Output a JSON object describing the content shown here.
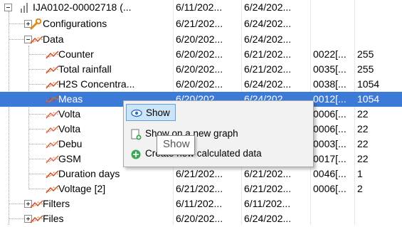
{
  "colors": {
    "selection": "#3b7ad6",
    "menu_hover": "#cce4f7",
    "menu_bg": "#f2f2f2"
  },
  "tree": {
    "rows": [
      {
        "name": "IJA0102-00002718 (...",
        "c1": "6/11/202...",
        "c2": "6/24/202...",
        "c3": "",
        "c4": "",
        "icon": "bar-chart-icon"
      },
      {
        "name": "Configurations",
        "c1": "6/21/202...",
        "c2": "6/24/202...",
        "c3": "",
        "c4": "",
        "icon": "wrench-icon"
      },
      {
        "name": "Data",
        "c1": "6/20/202...",
        "c2": "6/24/202...",
        "c3": "",
        "c4": "",
        "icon": "series-icon"
      },
      {
        "name": "Counter",
        "c1": "6/20/202...",
        "c2": "6/21/202...",
        "c3": "0022[...",
        "c4": "255",
        "icon": "series-icon"
      },
      {
        "name": "Total rainfall",
        "c1": "6/20/202...",
        "c2": "6/21/202...",
        "c3": "0035[...",
        "c4": "255",
        "icon": "series-icon"
      },
      {
        "name": "H2S Concentra...",
        "c1": "6/20/202...",
        "c2": "6/24/202...",
        "c3": "0038[...",
        "c4": "1054",
        "icon": "series-icon"
      },
      {
        "name": "Meas",
        "c1": "6/20/202...",
        "c2": "6/24/202...",
        "c3": "0012[...",
        "c4": "1054",
        "icon": "series-icon"
      },
      {
        "name": "Volta",
        "c1": "",
        "c2": "",
        "c3": "0006[...",
        "c4": "22",
        "icon": "series-icon"
      },
      {
        "name": "Volta",
        "c1": "",
        "c2": "",
        "c3": "0006[...",
        "c4": "22",
        "icon": "series-icon"
      },
      {
        "name": "Debu",
        "c1": "",
        "c2": "",
        "c3": "0003[...",
        "c4": "22",
        "icon": "series-icon"
      },
      {
        "name": "GSM",
        "c1": "",
        "c2": "",
        "c3": "0017[...",
        "c4": "22",
        "icon": "series-icon"
      },
      {
        "name": "Duration days",
        "c1": "6/21/202...",
        "c2": "6/21/202...",
        "c3": "0046[...",
        "c4": "1",
        "icon": "series-icon"
      },
      {
        "name": "Voltage [2]",
        "c1": "6/21/202...",
        "c2": "6/21/202...",
        "c3": "0006[...",
        "c4": "2",
        "icon": "series-icon"
      },
      {
        "name": "Filters",
        "c1": "6/11/202...",
        "c2": "6/11/202...",
        "c3": "",
        "c4": "",
        "icon": "series-icon"
      },
      {
        "name": "Files",
        "c1": "6/20/202...",
        "c2": "6/24/202...",
        "c3": "",
        "c4": "",
        "icon": "series-icon"
      }
    ]
  },
  "context_menu": {
    "items": [
      {
        "label": "Show",
        "icon": "eye-icon"
      },
      {
        "label": "Show on a new graph",
        "icon": "new-graph-icon"
      },
      {
        "label": "Create new calculated data",
        "icon": "add-icon"
      }
    ]
  },
  "tooltip": {
    "text": "Show"
  }
}
